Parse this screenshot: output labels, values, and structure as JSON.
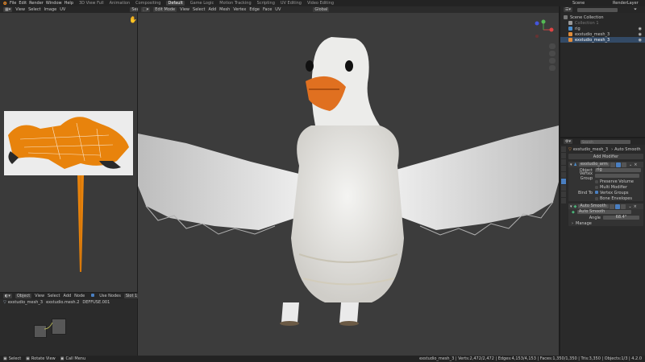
{
  "menu": {
    "items": [
      "File",
      "Edit",
      "Render",
      "Window",
      "Help"
    ],
    "workspaces": [
      "3D View Full",
      "Animation",
      "Compositing",
      "Default",
      "Game Logic",
      "Motion Tracking",
      "Scripting",
      "UV Editing",
      "Video Editing"
    ],
    "active_workspace": "Default",
    "scene": "Scene",
    "layer": "RenderLayer"
  },
  "uv_editor": {
    "menu": [
      "View",
      "Select",
      "Image",
      "UV"
    ],
    "image_button": "Searc"
  },
  "viewport": {
    "mode": "Edit Mode",
    "menu": [
      "View",
      "Select",
      "Add",
      "Mesh",
      "Vertex",
      "Edge",
      "Face",
      "UV"
    ],
    "orientation": "Global"
  },
  "node_editor": {
    "mode": "Object",
    "menu": [
      "View",
      "Select",
      "Add",
      "Node"
    ],
    "use_nodes_label": "Use Nodes",
    "slot": "Slot 1",
    "breadcrumb": [
      "exstudio_mesh_3",
      "exstudio.mesh.2",
      "DEFFUSE.001"
    ]
  },
  "outliner": {
    "search_placeholder": "",
    "items": [
      {
        "label": "Scene Collection",
        "indent": 0,
        "icon": "collection"
      },
      {
        "label": "Collection 1",
        "indent": 1,
        "icon": "collection"
      },
      {
        "label": "rig",
        "indent": 1,
        "icon": "armature"
      },
      {
        "label": "exstudio_mesh_3",
        "indent": 1,
        "icon": "mesh"
      },
      {
        "label": "exstudio_mesh_3",
        "indent": 1,
        "icon": "mesh"
      }
    ]
  },
  "properties": {
    "search_placeholder": "Search",
    "breadcrumb": [
      "exstudio_mesh_3",
      "Auto Smooth"
    ],
    "add_modifier": "Add Modifier",
    "armature_modifier": {
      "name": "exstudio_arm",
      "object_label": "Object",
      "object_value": "rig",
      "vertex_group_label": "Vertex Group",
      "preserve_volume": "Preserve Volume",
      "multi_modifier": "Multi Modifier",
      "bind_to_label": "Bind To",
      "vertex_groups": "Vertex Groups",
      "bone_envelopes": "Bone Envelopes"
    },
    "autosmooth_modifier": {
      "name": "Auto Smooth",
      "node_group": "Auto Smooth",
      "angle_label": "Angle",
      "angle_value": "68.4°",
      "manage_label": "Manage"
    }
  },
  "status": {
    "left": [
      "Select",
      "Rotate View",
      "Call Menu"
    ],
    "right": "exstudio_mesh_3 | Verts:2,472/2,472 | Edges:4,153/4,153 | Faces:1,350/1,350 | Tris:3,350 | Objects:1/3 | 4.2.0"
  },
  "colors": {
    "accent": "#4a7fc1",
    "duck_beak": "#e07020",
    "uv_islands": "#e8830c"
  }
}
